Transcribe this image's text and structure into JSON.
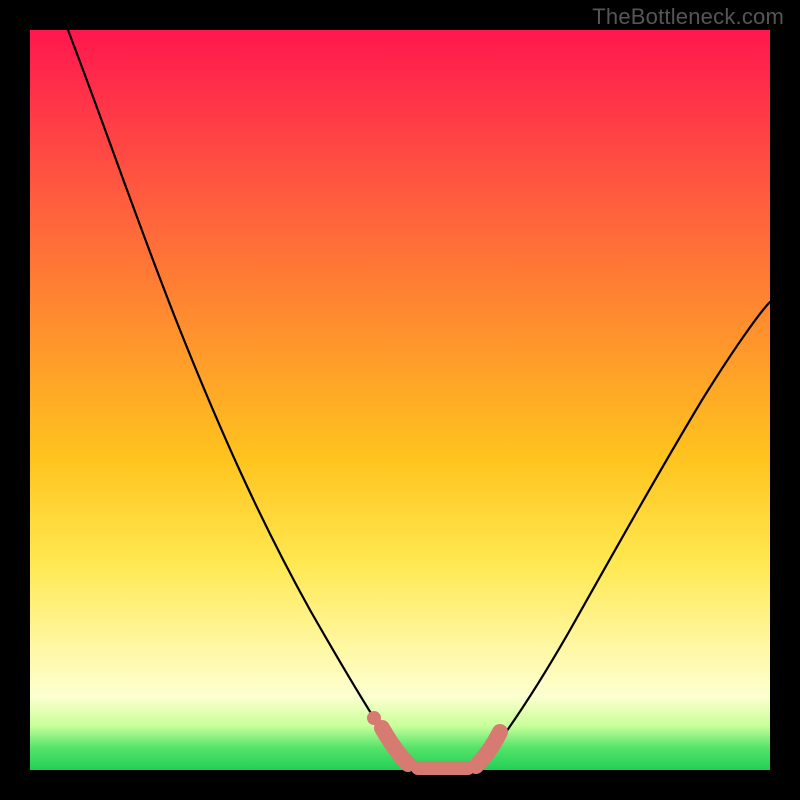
{
  "watermark": "TheBottleneck.com",
  "chart_data": {
    "type": "line",
    "title": "",
    "xlabel": "",
    "ylabel": "",
    "xlim": [
      0,
      100
    ],
    "ylim": [
      0,
      100
    ],
    "series": [
      {
        "name": "left-curve",
        "x": [
          5,
          10,
          15,
          20,
          25,
          30,
          35,
          40,
          45,
          48,
          50,
          52
        ],
        "values": [
          100,
          86,
          73,
          61,
          50,
          40,
          31,
          22,
          12,
          6,
          2,
          0
        ]
      },
      {
        "name": "right-curve",
        "x": [
          60,
          62,
          65,
          70,
          75,
          80,
          85,
          90,
          95,
          100
        ],
        "values": [
          0,
          2,
          6,
          13,
          21,
          30,
          39,
          48,
          56,
          61
        ]
      },
      {
        "name": "bottleneck-range-highlight",
        "x": [
          48,
          50,
          52,
          54,
          56,
          58,
          60,
          62
        ],
        "values": [
          3,
          1,
          0,
          0,
          0,
          0,
          0,
          2
        ]
      }
    ],
    "colors": {
      "curve": "#000000",
      "highlight": "#d77a72",
      "gradient_top": "#ff174e",
      "gradient_bottom": "#23cf57"
    }
  }
}
